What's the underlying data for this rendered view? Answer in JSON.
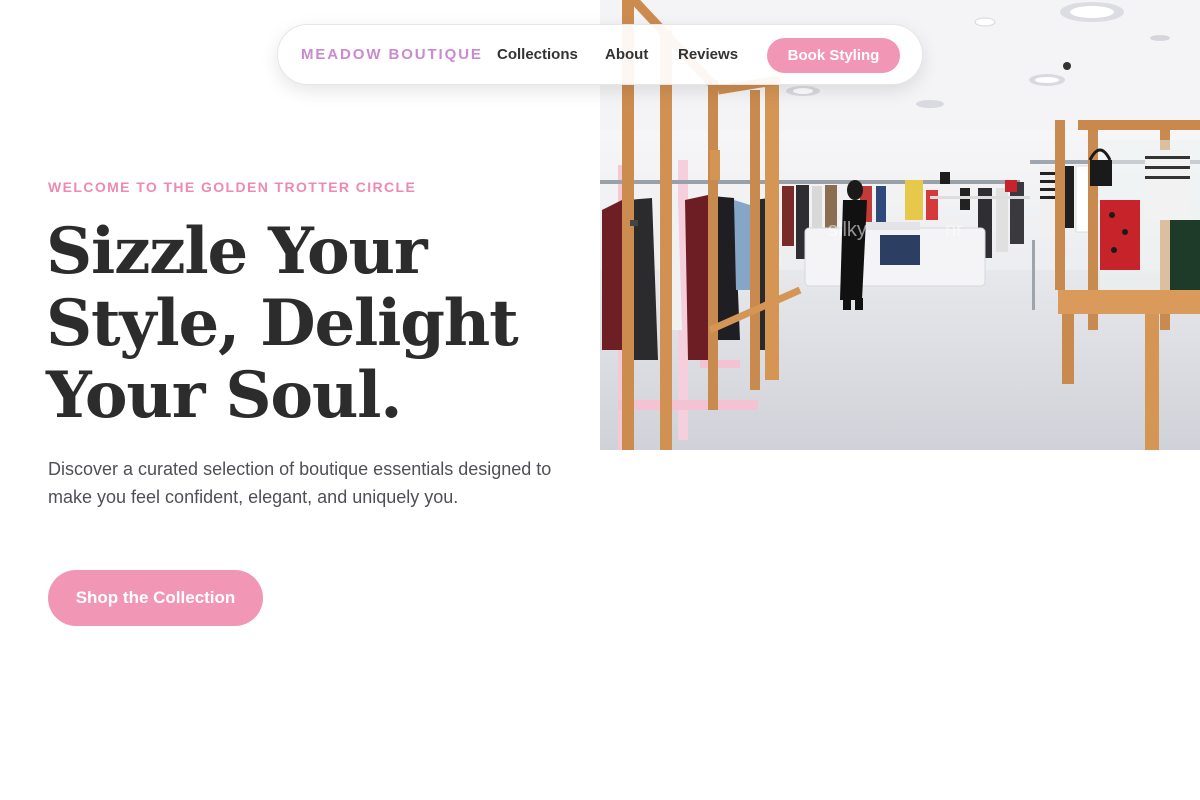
{
  "nav": {
    "brand": "MEADOW BOUTIQUE",
    "links": [
      "Collections",
      "About",
      "Reviews"
    ],
    "cta": "Book Styling"
  },
  "hero": {
    "eyebrow": "WELCOME TO THE GOLDEN TROTTER CIRCLE",
    "headline_lines": [
      "Sizzle Your",
      "Style, Delight",
      "Your Soul."
    ],
    "description": "Discover a curated selection of boutique essentials designed to make you feel confident, elegant, and uniquely you.",
    "cta": "Shop the Collection"
  },
  "colors": {
    "accent_pink": "#f296b5",
    "brand_lilac": "#c98ad2",
    "eyebrow_pink": "#ee8ab0",
    "heading": "#2c2c2c"
  },
  "image": {
    "subject": "boutique-interior-photo"
  }
}
